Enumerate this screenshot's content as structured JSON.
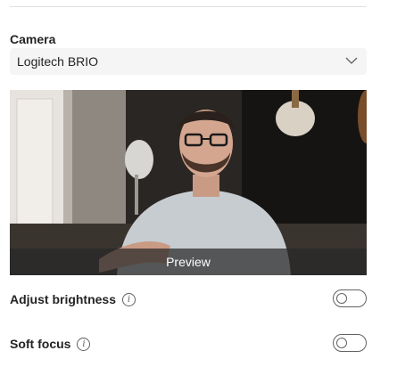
{
  "camera": {
    "label": "Camera",
    "selected": "Logitech BRIO"
  },
  "preview": {
    "label": "Preview"
  },
  "settings": [
    {
      "label": "Adjust brightness",
      "enabled": false
    },
    {
      "label": "Soft focus",
      "enabled": false
    }
  ],
  "icons": {
    "dropdown": "chevron-down-icon",
    "info": "info-icon"
  },
  "info_glyph": "i"
}
